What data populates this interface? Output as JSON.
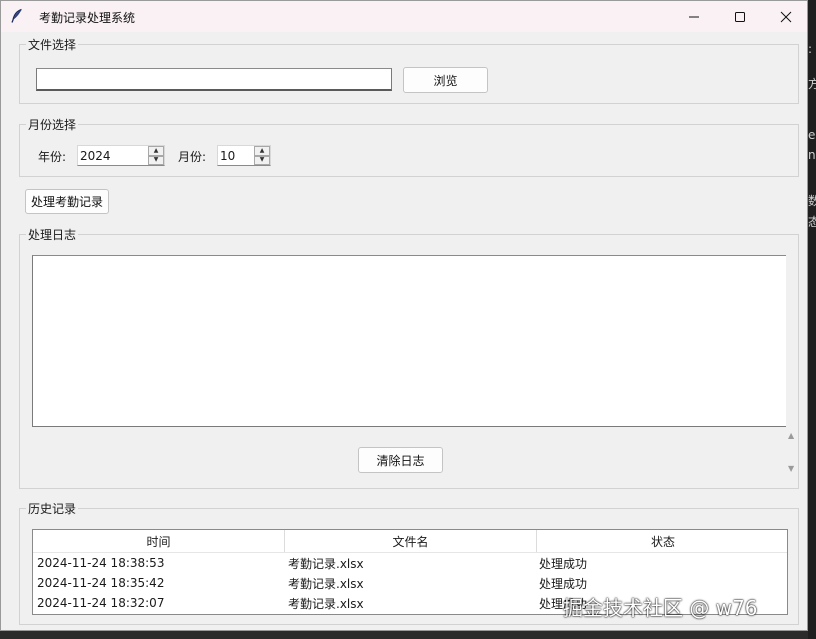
{
  "window": {
    "title": "考勤记录处理系统"
  },
  "file_section": {
    "legend": "文件选择",
    "path_value": "",
    "browse_label": "浏览"
  },
  "month_section": {
    "legend": "月份选择",
    "year_label": "年份:",
    "year_value": "2024",
    "month_label": "月份:",
    "month_value": "10"
  },
  "process_button_label": "处理考勤记录",
  "log_section": {
    "legend": "处理日志",
    "content": "",
    "clear_label": "清除日志"
  },
  "history_section": {
    "legend": "历史记录",
    "columns": [
      "时间",
      "文件名",
      "状态"
    ],
    "rows": [
      [
        "2024-11-24 18:38:53",
        "考勤记录.xlsx",
        "处理成功"
      ],
      [
        "2024-11-24 18:35:42",
        "考勤记录.xlsx",
        "处理成功"
      ],
      [
        "2024-11-24 18:32:07",
        "考勤记录.xlsx",
        "处理成功"
      ]
    ]
  },
  "watermark": "掘金技术社区 @ w76"
}
